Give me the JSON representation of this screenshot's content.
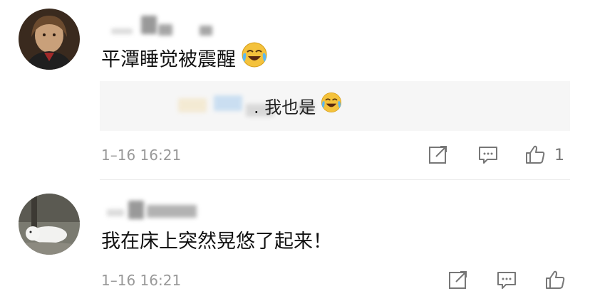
{
  "comments": [
    {
      "text": "平潭睡觉被震醒",
      "reply": {
        "text": ". 我也是"
      },
      "time": "1–16 16:21",
      "like_count": "1",
      "icons": [
        "share-icon",
        "comment-icon",
        "thumb-up-icon"
      ]
    },
    {
      "text": "我在床上突然晃悠了起来！",
      "time": "1–16 16:21",
      "like_count": "",
      "icons": [
        "share-icon",
        "comment-icon",
        "thumb-up-icon"
      ]
    }
  ],
  "colors": {
    "background": "#ffffff",
    "reply_box": "#f6f6f6",
    "meta_text": "#999999",
    "emoji_yellow": "#f4c23c"
  }
}
